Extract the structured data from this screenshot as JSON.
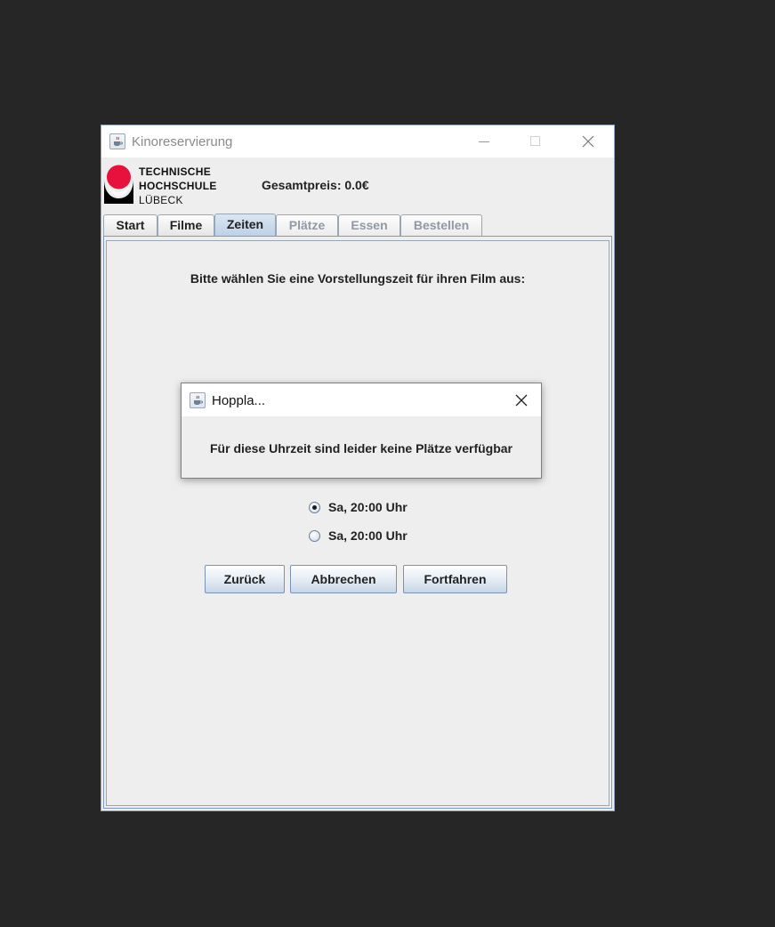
{
  "window": {
    "title": "Kinoreservierung",
    "icon": "java-cup-icon"
  },
  "header": {
    "logo_lines": [
      "TECHNISCHE",
      "HOCHSCHULE",
      "LÜBECK"
    ],
    "total_price": "Gesamtpreis: 0.0€"
  },
  "tabs": [
    {
      "label": "Start",
      "state": "normal"
    },
    {
      "label": "Filme",
      "state": "normal"
    },
    {
      "label": "Zeiten",
      "state": "active"
    },
    {
      "label": "Plätze",
      "state": "disabled"
    },
    {
      "label": "Essen",
      "state": "disabled"
    },
    {
      "label": "Bestellen",
      "state": "disabled"
    }
  ],
  "main": {
    "prompt": "Bitte wählen Sie eine Vorstellungszeit für ihren Film aus:",
    "options": [
      {
        "label": "Sa, 20:00 Uhr",
        "checked": true
      },
      {
        "label": "Sa, 20:00 Uhr",
        "checked": false
      }
    ],
    "buttons": {
      "back": "Zurück",
      "cancel": "Abbrechen",
      "continue": "Fortfahren"
    }
  },
  "dialog": {
    "title": "Hoppla...",
    "message": "Für diese Uhrzeit sind leider keine Plätze verfügbar"
  },
  "colors": {
    "background": "#262626",
    "window_bg": "#eeeeee",
    "logo_red": "#e8103c",
    "tab_active": "#bcd0e6",
    "disabled_text": "#8f9aa6"
  }
}
